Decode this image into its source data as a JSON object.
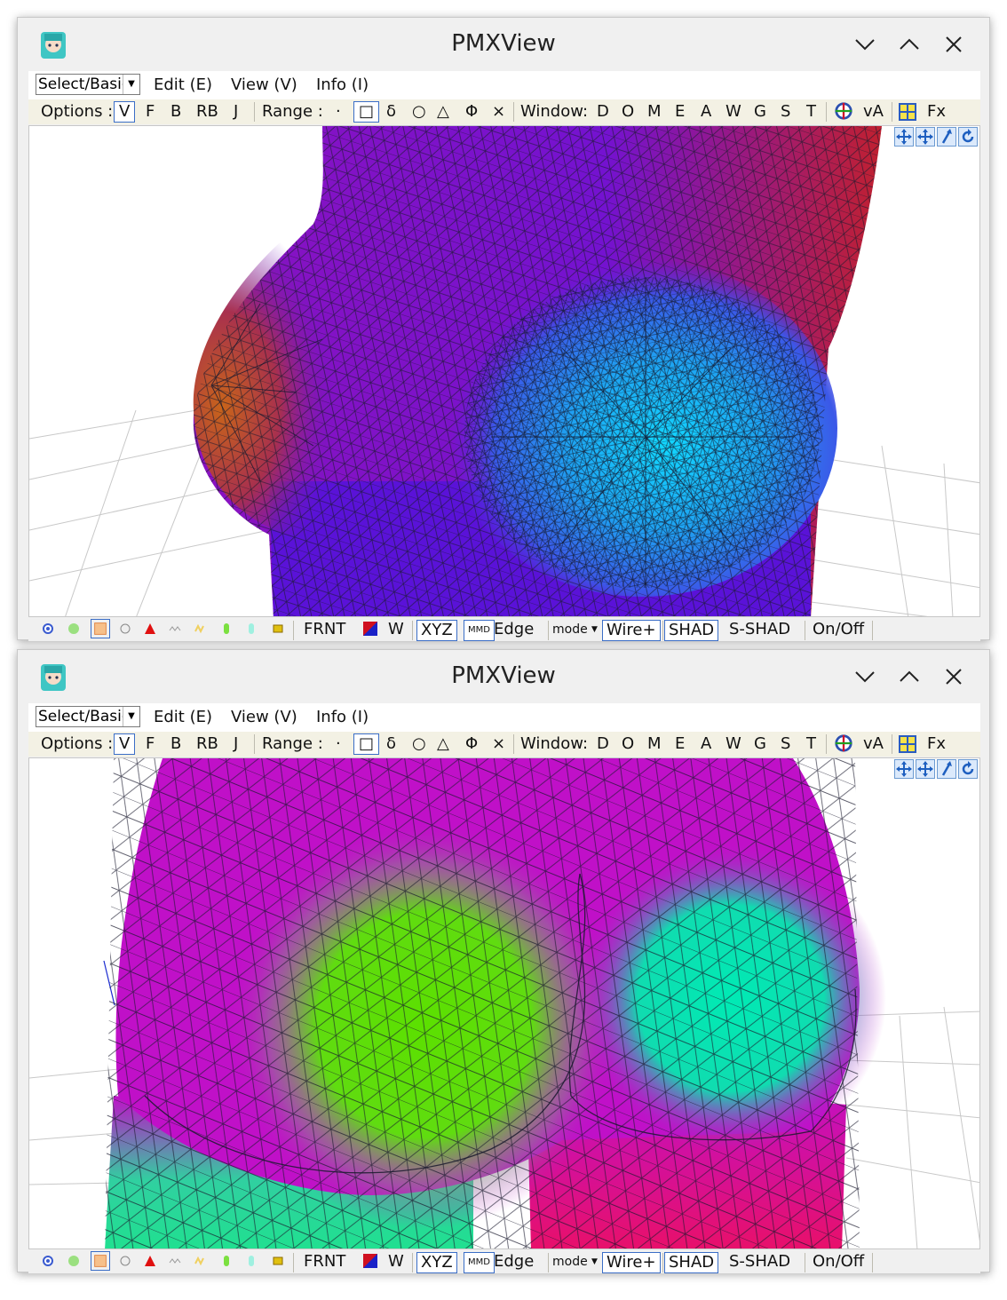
{
  "windows": [
    {
      "title": "PMXView",
      "combo_value": "Select/Basic",
      "menus": [
        "Edit (E)",
        "View (V)",
        "Info (I)"
      ],
      "view": "chest"
    },
    {
      "title": "PMXView",
      "combo_value": "Select/Basic",
      "menus": [
        "Edit (E)",
        "View (V)",
        "Info (I)"
      ],
      "view": "hips"
    }
  ],
  "toolbar": {
    "options_label": "Options :",
    "options": [
      "V",
      "F",
      "B",
      "RB",
      "J"
    ],
    "range_label": "Range :",
    "range_items": [
      "·",
      "□",
      "δ",
      "○",
      "△",
      "Φ",
      "×"
    ],
    "window_label": "Window:",
    "window_items": [
      "D",
      "O",
      "M",
      "E",
      "A",
      "W",
      "G",
      "S",
      "T"
    ],
    "va_label": "vA",
    "fx_label": "Fx"
  },
  "statusbar": {
    "frnt": "FRNT",
    "w": "W",
    "xyz": "XYZ",
    "mmd": "MMD",
    "edge": "Edge",
    "mode": "mode",
    "wire": "Wire+",
    "shad": "SHAD",
    "sshad": "S-SHAD",
    "onoff": "On/Off"
  },
  "icons": {
    "minimize": "chevron-down-icon",
    "maximize": "chevron-up-icon",
    "close": "close-icon",
    "app": "miku-avatar-icon"
  },
  "colors": {
    "accent": "#3b6ec7",
    "chest_purple": "#6a12d8",
    "chest_blue": "#1fb0f0",
    "chest_orange": "#c45a1a",
    "hips_magenta": "#c010c8",
    "hips_green": "#5adc10",
    "hips_teal": "#10e0b0",
    "hips_pink": "#e0107a"
  }
}
